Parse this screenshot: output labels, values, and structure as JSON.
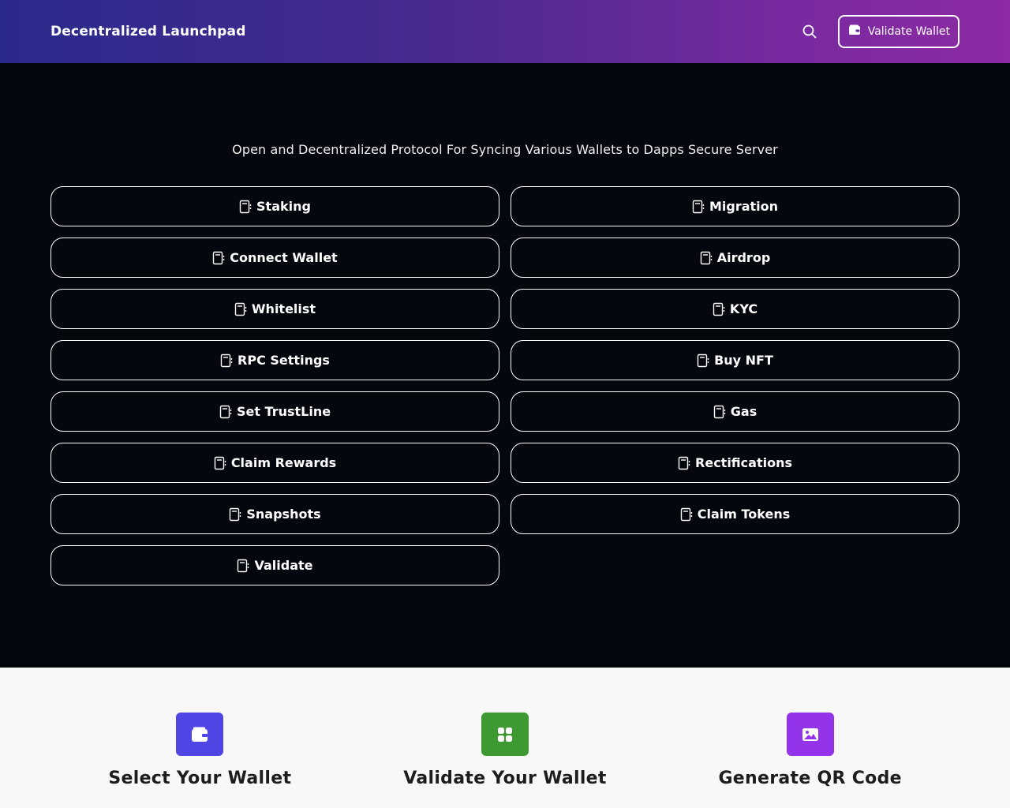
{
  "header": {
    "brand": "Decentralized Launchpad",
    "search_icon": "search-icon",
    "validate_label": "Validate Wallet",
    "validate_icon": "wallet-icon"
  },
  "hero": {
    "tagline": "Open and Decentralized Protocol For Syncing Various Wallets to Dapps Secure Server"
  },
  "actions": [
    {
      "label": "Staking",
      "icon": "clipboard-icon"
    },
    {
      "label": "Migration",
      "icon": "clipboard-icon"
    },
    {
      "label": "Connect Wallet",
      "icon": "clipboard-icon"
    },
    {
      "label": "Airdrop",
      "icon": "clipboard-icon"
    },
    {
      "label": "Whitelist",
      "icon": "clipboard-icon"
    },
    {
      "label": "KYC",
      "icon": "clipboard-icon"
    },
    {
      "label": "RPC Settings",
      "icon": "clipboard-icon"
    },
    {
      "label": "Buy NFT",
      "icon": "clipboard-icon"
    },
    {
      "label": "Set TrustLine",
      "icon": "clipboard-icon"
    },
    {
      "label": "Gas",
      "icon": "clipboard-icon"
    },
    {
      "label": "Claim Rewards",
      "icon": "clipboard-icon"
    },
    {
      "label": "Rectifications",
      "icon": "clipboard-icon"
    },
    {
      "label": "Snapshots",
      "icon": "clipboard-icon"
    },
    {
      "label": "Claim Tokens",
      "icon": "clipboard-icon"
    },
    {
      "label": "Validate",
      "icon": "clipboard-icon"
    }
  ],
  "features": [
    {
      "title": "Select Your Wallet",
      "icon": "wallet-icon",
      "color": "#4f46e5"
    },
    {
      "title": "Validate Your Wallet",
      "icon": "grid-icon",
      "color": "#3d9a32"
    },
    {
      "title": "Generate QR Code",
      "icon": "image-icon",
      "color": "#9333ea"
    }
  ],
  "colors": {
    "header_gradient_start": "#2a2a8c",
    "header_gradient_end": "#8e2aa3",
    "hero_bg": "#05070f",
    "features_bg": "#f8f8f8"
  }
}
